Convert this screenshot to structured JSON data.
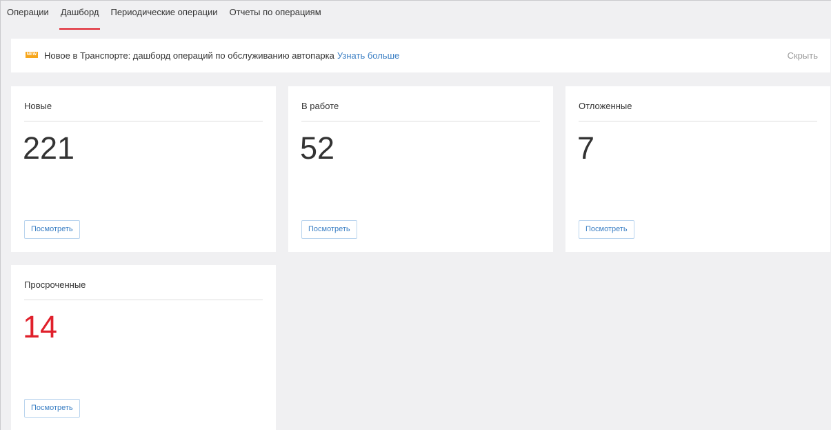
{
  "tabs": [
    {
      "label": "Операции",
      "active": false
    },
    {
      "label": "Дашборд",
      "active": true
    },
    {
      "label": "Периодические операции",
      "active": false
    },
    {
      "label": "Отчеты по операциям",
      "active": false
    }
  ],
  "banner": {
    "badge": "NEW",
    "text": "Новое в Транспорте: дашборд операций по обслуживанию автопарка",
    "link": "Узнать больше",
    "hide": "Скрыть"
  },
  "cards": [
    {
      "title": "Новые",
      "value": "221",
      "button": "Посмотреть"
    },
    {
      "title": "В работе",
      "value": "52",
      "button": "Посмотреть"
    },
    {
      "title": "Отложенные",
      "value": "7",
      "button": "Посмотреть"
    },
    {
      "title": "Просроченные",
      "value": "14",
      "button": "Посмотреть",
      "value_color": "#e0202b"
    }
  ],
  "colors": {
    "accent_red": "#e0202b",
    "link_blue": "#3b7fc4",
    "badge_orange": "#f7a61c",
    "background": "#f0f0f2"
  }
}
